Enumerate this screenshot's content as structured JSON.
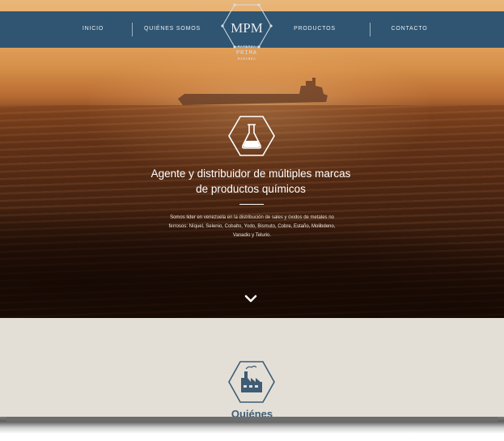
{
  "nav": {
    "items": [
      {
        "label": "INICIO"
      },
      {
        "label": "QUIÉNES SOMOS"
      },
      {
        "label": "PRODUCTOS"
      },
      {
        "label": "CONTACTO"
      }
    ]
  },
  "logo": {
    "initials": "MPM",
    "line1": "MATERIA",
    "line2": "PRIMA",
    "line3": "MIRANDA"
  },
  "hero": {
    "icon": "flask-icon",
    "title_line1": "Agente y distribuidor de múltiples marcas",
    "title_line2": "de productos químicos",
    "desc_line1": "Somos lider en venezuela en la distribución de sales y óxidos de metales no",
    "desc_line2": "ferrosos: Níquel, Selenio, Cobalto, Yodo, Bismuto, Cobre, Estaño, Molibdeno,",
    "desc_line3": "Vanadio y Telurio.",
    "scroll_icon": "chevron-down-icon"
  },
  "about": {
    "icon": "factory-icon",
    "title": "Quiénes"
  },
  "colors": {
    "nav_bg": "#2f5572",
    "accent": "#3e5c74",
    "section_bg": "#e3dfd7"
  }
}
